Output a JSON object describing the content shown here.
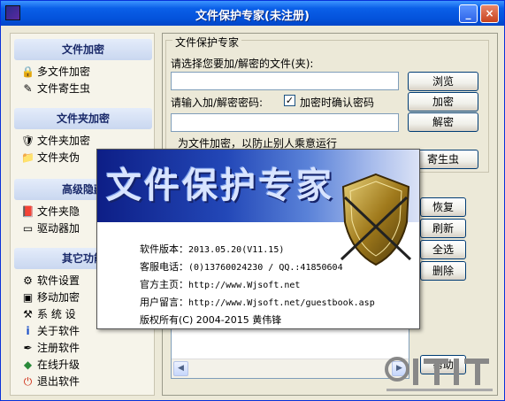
{
  "window": {
    "title": "文件保护专家(未注册)",
    "minimize": "_",
    "close": "×"
  },
  "sidebar": {
    "groups": [
      {
        "title": "文件加密",
        "items": [
          {
            "label": "多文件加密",
            "icon": "multi-file-encrypt-icon",
            "glyph": "🔒"
          },
          {
            "label": "文件寄生虫",
            "icon": "file-parasite-icon",
            "glyph": "✎"
          }
        ]
      },
      {
        "title": "文件夹加密",
        "items": [
          {
            "label": "文件夹加密",
            "icon": "folder-encrypt-icon",
            "glyph": "🛡"
          },
          {
            "label": "文件夹伪",
            "icon": "folder-disguise-icon",
            "glyph": "📁"
          }
        ]
      },
      {
        "title": "高级隐藏",
        "items": [
          {
            "label": "文件夹隐",
            "icon": "folder-hide-icon",
            "glyph": "📕"
          },
          {
            "label": "驱动器加",
            "icon": "drive-encrypt-icon",
            "glyph": "▭"
          }
        ]
      },
      {
        "title": "其它功能",
        "items": [
          {
            "label": "软件设置",
            "icon": "settings-icon",
            "glyph": "⚙"
          },
          {
            "label": "移动加密",
            "icon": "mobile-encrypt-icon",
            "glyph": "▣"
          },
          {
            "label": "系 统 设",
            "icon": "system-icon",
            "glyph": "⚒"
          },
          {
            "label": "关于软件",
            "icon": "info-icon",
            "glyph": "i"
          },
          {
            "label": "注册软件",
            "icon": "register-icon",
            "glyph": "✒"
          },
          {
            "label": "在线升级",
            "icon": "upgrade-icon",
            "glyph": "◆"
          },
          {
            "label": "退出软件",
            "icon": "exit-icon",
            "glyph": "⏻"
          }
        ]
      }
    ]
  },
  "main": {
    "legend": "文件保护专家",
    "file_prompt": "请选择您要加/解密的文件(夹):",
    "file_value": "",
    "password_prompt": "请输入加/解密密码:",
    "confirm_label": "加密时确认密码",
    "confirm_checked": "✓",
    "password_value": "",
    "parasite_tip": "为文件加密，以防止别人乘意运行",
    "buttons": {
      "browse": "浏览",
      "encrypt": "加密",
      "decrypt": "解密",
      "parasite": "寄生虫",
      "restore": "恢复",
      "refresh": "刷新",
      "select_all": "全选",
      "delete": "删除",
      "help": "帮助"
    }
  },
  "splash": {
    "title": "文件保护专家",
    "version_label": "软件版本：",
    "version": "2013.05.20(V11.15)",
    "phone_label": "客服电话：",
    "phone": "(0)13760024230 / QQ.:41850604",
    "site_label": "官方主页：",
    "site": "http://www.Wjsoft.net",
    "guestbook_label": "用户留言：",
    "guestbook": "http://www.Wjsoft.net/guestbook.asp",
    "copyright": "版权所有(C) 2004-2015 黄伟锋"
  },
  "colors": {
    "title_bar": "#0453DC",
    "window_bg": "#ECE9D8",
    "group_head": "#C9D7F0",
    "splash_band": "#2348B8"
  }
}
